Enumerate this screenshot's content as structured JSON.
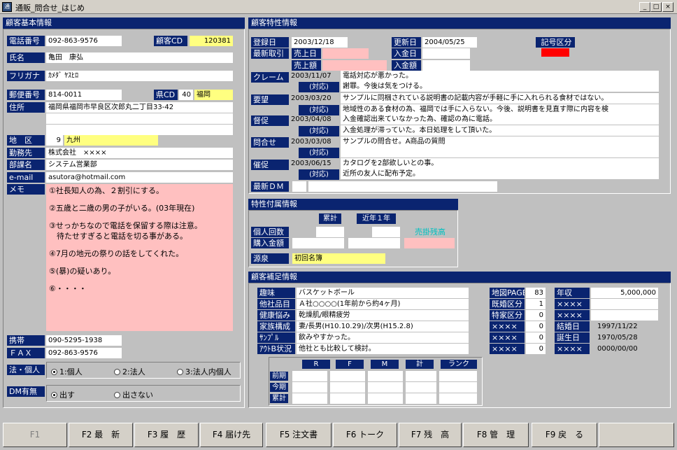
{
  "window": {
    "title": "通販_問合せ_はじめ",
    "min": "_",
    "max": "□",
    "close": "×"
  },
  "left": {
    "header": "顧客基本情報",
    "tel_label": "電話番号",
    "tel": "092-863-9576",
    "custcd_label": "顧客CD",
    "custcd": "120381",
    "name_label": "氏名",
    "name": "亀田　康弘",
    "furigana_label": "フリガナ",
    "furigana": "ｶﾒﾀﾞ ﾔｽﾋﾛ",
    "zip_label": "郵便番号",
    "zip": "814-0011",
    "pref_label": "県CD",
    "pref_code": "40",
    "pref_name": "福岡",
    "addr_label": "住所",
    "addr1": "福岡県福岡市早良区次郎丸二丁目33-42",
    "addr2": "",
    "addr3": "",
    "area_label": "地　区",
    "area_code": "9",
    "area_name": "九州",
    "company_label": "勤務先",
    "company": "株式会社　××××",
    "dept_label": "部課名",
    "dept": "システム営業部",
    "email_label": "e-mail",
    "email": "asutora@hotmail.com",
    "memo_label": "メモ",
    "memo": [
      "①社長知人の為、２割引にする。",
      "②五歳と二歳の男の子がいる。(03年現在)",
      "③せっかちなので電話を保留する際は注意。",
      "　待たせすぎると電話を切る事がある。",
      "④7月の地元の祭りの話をしてくれた。",
      "⑤(暴)の疑いあり。",
      "⑥・・・・"
    ],
    "mobile_label": "携帯",
    "mobile": "090-5295-1938",
    "fax_label": "ＦＡＸ",
    "fax": "092-863-9576",
    "corp_label": "法・個人",
    "corp_opts": [
      "1:個人",
      "2:法人",
      "3:法人内個人"
    ],
    "dm_label": "DM有無",
    "dm_opts": [
      "出す",
      "出さない"
    ]
  },
  "right": {
    "header": "顧客特性情報",
    "reg_label": "登録日",
    "reg": "2003/12/18",
    "upd_label": "更新日",
    "upd": "2004/05/25",
    "kigo_label": "記号区分",
    "last_label": "最新取引",
    "sale_date_label": "売上日",
    "pay_date_label": "入金日",
    "sale_amt_label": "売上額",
    "pay_amt_label": "入金額",
    "claim_label": "クレーム",
    "claim_date": "2003/11/07",
    "claim_text": "電話対応が悪かった。",
    "resp_label": "(対応)",
    "claim_resp": "謝罪。今後は気をつける。",
    "req_label": "要望",
    "req_date": "2003/03/20",
    "req_text": "サンプルに同梱されている説明書の記載内容が手軽に手に入れられる食材ではない。",
    "req_resp": "地域性のある食材の為、福岡では手に入らない。今後、説明書を見直す際に内容を検",
    "dun_label": "督促",
    "dun_date": "2003/04/08",
    "dun_text": "入金確認出来ていなかった為、確認の為に電話。",
    "dun_resp": "入金処理が滞っていた。本日処理をして頂いた。",
    "inq_label": "問合せ",
    "inq_date": "2003/03/08",
    "inq_text": "サンプルの問合せ。A商品の質問",
    "inq_resp": "",
    "promo_label": "催促",
    "promo_date": "2003/06/15",
    "promo_text": "カタログを2部欲しいとの事。",
    "promo_resp": "近所の友人に配布予定。",
    "dm_label": "最新ＤＭ",
    "dm_val": ""
  },
  "attr": {
    "header": "特性付属情報",
    "col1": "累計",
    "col2": "近年１年",
    "count_label": "個人回数",
    "amount_label": "購入金額",
    "unpaid_label": "売掛残高",
    "source_label": "源泉",
    "source": "初回名簿"
  },
  "supp": {
    "header": "顧客補足情報",
    "hobby_label": "趣味",
    "hobby": "バスケットボール",
    "other_label": "他社品目",
    "other": "Ａ社○○○○(1年前から約4ヶ月)",
    "health_label": "健康悩み",
    "health": "乾燥肌/眼精疲労",
    "family_label": "家族構成",
    "family": "妻/長男(H10.10.29)/次男(H15.2.8)",
    "sample_label": "ｻﾝﾌﾟﾙ",
    "sample": "飲みやすかった。",
    "out_label": "ｱｳﾄB状況",
    "out": "他社とも比較して検討。",
    "map_label": "地図PAGE",
    "map": "83",
    "married_label": "既婚区分",
    "married": "1",
    "special_label": "特家区分",
    "special": "0",
    "x_label": "××××",
    "x1": "0",
    "x2": "0",
    "x3": "0",
    "income_label": "年収",
    "income": "5,000,000",
    "wed_label": "結婚日",
    "wed": "1997/11/22",
    "birth_label": "誕生日",
    "birth": "1970/05/28",
    "x4": "0000/00/00",
    "grid_cols": [
      "R",
      "F",
      "M",
      "計",
      "ランク"
    ],
    "grid_rows": [
      "前期",
      "今期",
      "累計"
    ]
  },
  "fkeys": [
    "F1",
    "F2 最　新",
    "F3 履　歴",
    "F4 届け先",
    "F5 注文書",
    "F6 トーク",
    "F7 残　高",
    "F8 管　理",
    "F9 戻　る",
    ""
  ],
  "colors": {
    "label_bg": "#0a2470",
    "memo_bg": "#ffc0c0",
    "highlight": "#ffff80"
  }
}
